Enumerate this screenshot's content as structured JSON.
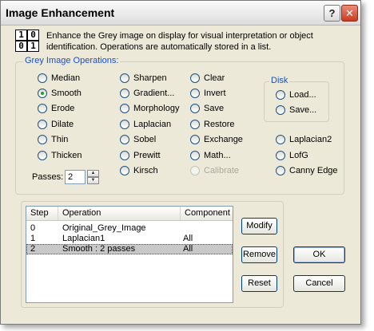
{
  "window": {
    "title": "Image Enhancement"
  },
  "titlebar": {
    "help_glyph": "?",
    "close_glyph": "✕"
  },
  "logo": {
    "digits": [
      "1",
      "0",
      "0",
      "1"
    ]
  },
  "intro": "Enhance the Grey image on display for visual interpretation or object identification. Operations are automatically stored in a list.",
  "grey_ops": {
    "legend": "Grey Image Operations:",
    "col1": [
      "Median",
      "Smooth",
      "Erode",
      "Dilate",
      "Thin",
      "Thicken"
    ],
    "col2": [
      "Sharpen",
      "Gradient...",
      "Morphology",
      "Laplacian",
      "Sobel",
      "Prewitt",
      "Kirsch"
    ],
    "col3": [
      "Clear",
      "Invert",
      "Save",
      "Restore",
      "Exchange",
      "Math...",
      "Calibrate"
    ],
    "col4": [
      "Laplacian2",
      "LofG",
      "Canny Edge"
    ],
    "selected": "Smooth",
    "disabled": [
      "Calibrate"
    ]
  },
  "disk": {
    "legend": "Disk",
    "load": "Load...",
    "save": "Save..."
  },
  "passes": {
    "label": "Passes:",
    "value": "2"
  },
  "history": {
    "columns": [
      "Step",
      "Operation",
      "Component"
    ],
    "rows": [
      {
        "step": "0",
        "operation": "Original_Grey_Image",
        "component": ""
      },
      {
        "step": "1",
        "operation": "Laplacian1",
        "component": "All"
      },
      {
        "step": "2",
        "operation": "Smooth : 2 passes",
        "component": "All"
      }
    ],
    "selected_index": 2
  },
  "buttons": {
    "modify": "Modify",
    "remove": "Remove",
    "reset": "Reset",
    "ok": "OK",
    "cancel": "Cancel"
  }
}
